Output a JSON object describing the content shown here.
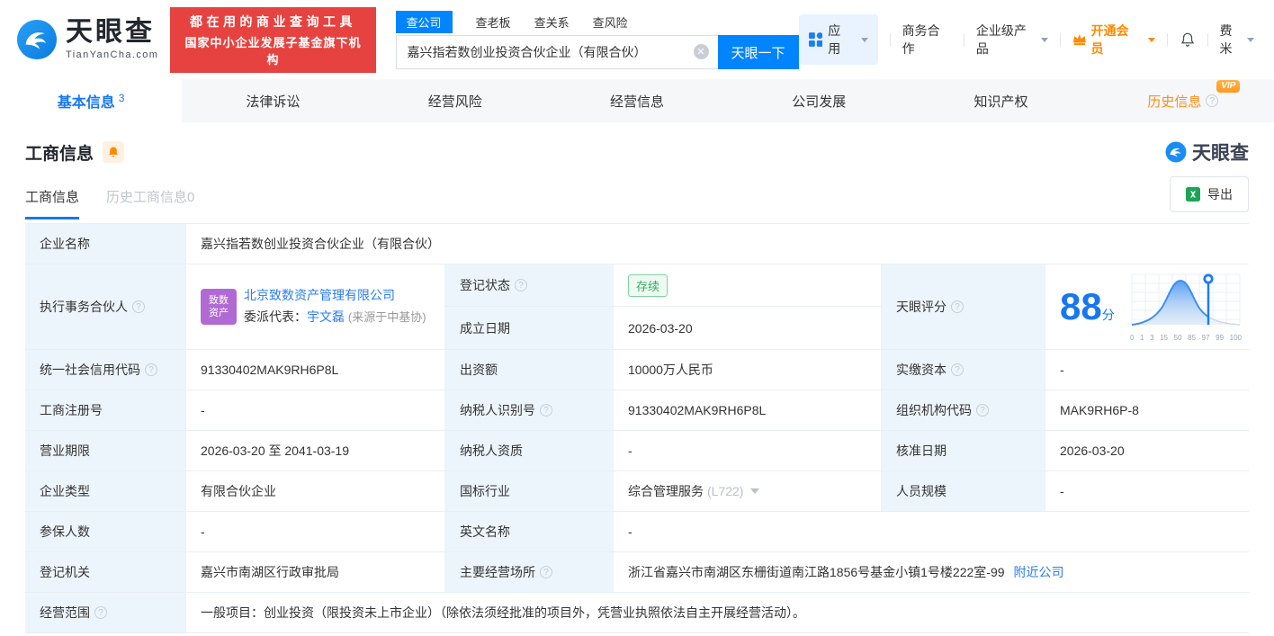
{
  "header": {
    "brand": "天眼查",
    "brand_domain": "TianYanCha.com",
    "slogan_line1": "都在用的商业查询工具",
    "slogan_line2": "国家中小企业发展子基金旗下机构",
    "search_tabs": [
      {
        "label": "查公司"
      },
      {
        "label": "查老板"
      },
      {
        "label": "查关系"
      },
      {
        "label": "查风险"
      }
    ],
    "search_value": "嘉兴指若数创业投资合伙企业（有限合伙）",
    "search_button": "天眼一下",
    "menu_apps": "应用",
    "menu_cooperation": "商务合作",
    "menu_enterprise": "企业级产品",
    "menu_vip": "开通会员",
    "menu_user": "费米"
  },
  "nav_tabs": [
    {
      "label": "基本信息",
      "count": "3"
    },
    {
      "label": "法律诉讼"
    },
    {
      "label": "经营风险"
    },
    {
      "label": "经营信息"
    },
    {
      "label": "公司发展"
    },
    {
      "label": "知识产权"
    },
    {
      "label": "历史信息",
      "badge": "VIP"
    }
  ],
  "section": {
    "title": "工商信息",
    "subtab_current": "工商信息",
    "subtab_history": "历史工商信息0",
    "watermark": "天眼查",
    "export_label": "导出"
  },
  "info": {
    "company_name_label": "企业名称",
    "company_name": "嘉兴指若数创业投资合伙企业（有限合伙）",
    "partner_label": "执行事务合伙人",
    "partner_avatar_line1": "致数",
    "partner_avatar_line2": "资产",
    "partner_company": "北京致数资产管理有限公司",
    "partner_rep_prefix": "委派代表：",
    "partner_rep_name": "宇文磊",
    "partner_rep_source": "(来源于中基协)",
    "status_label": "登记状态",
    "status": "存续",
    "established_label": "成立日期",
    "established": "2026-03-20",
    "score_label": "天眼评分",
    "uscc_label": "统一社会信用代码",
    "uscc": "91330402MAK9RH6P8L",
    "capital_label": "出资额",
    "capital": "10000万人民币",
    "paid_capital_label": "实缴资本",
    "paid_capital": "-",
    "reg_no_label": "工商注册号",
    "reg_no": "-",
    "tax_id_label": "纳税人识别号",
    "tax_id": "91330402MAK9RH6P8L",
    "org_code_label": "组织机构代码",
    "org_code": "MAK9RH6P-8",
    "term_label": "营业期限",
    "term": "2026-03-20 至 2041-03-19",
    "tax_qual_label": "纳税人资质",
    "tax_qual": "-",
    "approval_date_label": "核准日期",
    "approval_date": "2026-03-20",
    "company_type_label": "企业类型",
    "company_type": "有限合伙企业",
    "industry_label": "国标行业",
    "industry": "综合管理服务",
    "industry_code": "(L722)",
    "staff_size_label": "人员规模",
    "staff_size": "-",
    "insured_label": "参保人数",
    "insured": "-",
    "english_name_label": "英文名称",
    "english_name": "-",
    "authority_label": "登记机关",
    "authority": "嘉兴市南湖区行政审批局",
    "premises_label": "主要经营场所",
    "premises": "浙江省嘉兴市南湖区东栅街道南江路1856号基金小镇1号楼222室-99",
    "nearby_link": "附近公司",
    "scope_label": "经营范围",
    "scope": "一般项目：创业投资（限投资未上市企业）（除依法须经批准的项目外，凭营业执照依法自主开展经营活动）。"
  },
  "score": {
    "value": "88",
    "unit": "分",
    "axis": [
      "0",
      "1",
      "3",
      "15",
      "50",
      "85",
      "97",
      "99",
      "100"
    ]
  }
}
